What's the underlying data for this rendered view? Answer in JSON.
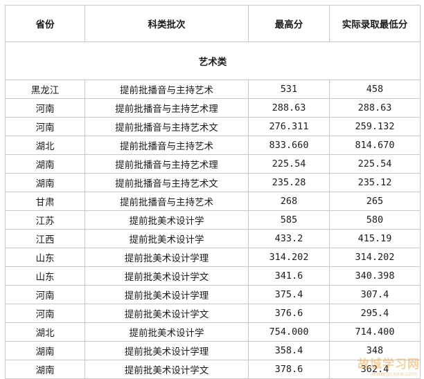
{
  "table": {
    "headers": {
      "province": "省份",
      "batch": "科类批次",
      "max": "最高分",
      "min": "实际录取最低分"
    },
    "section_title": "艺术类",
    "rows": [
      {
        "province": "黑龙江",
        "batch": "提前批播音与主持艺术",
        "max": "531",
        "min": "458"
      },
      {
        "province": "河南",
        "batch": "提前批播音与主持艺术理",
        "max": "288.63",
        "min": "288.63"
      },
      {
        "province": "河南",
        "batch": "提前批播音与主持艺术文",
        "max": "276.311",
        "min": "259.132"
      },
      {
        "province": "湖北",
        "batch": "提前批播音与主持艺术",
        "max": "833.660",
        "min": "814.670"
      },
      {
        "province": "湖南",
        "batch": "提前批播音与主持艺术理",
        "max": "225.54",
        "min": "225.54"
      },
      {
        "province": "湖南",
        "batch": "提前批播音与主持艺术文",
        "max": "235.28",
        "min": "235.12"
      },
      {
        "province": "甘肃",
        "batch": "提前批播音与主持艺术",
        "max": "268",
        "min": "265"
      },
      {
        "province": "江苏",
        "batch": "提前批美术设计学",
        "max": "585",
        "min": "580"
      },
      {
        "province": "江西",
        "batch": "提前批美术设计学",
        "max": "433.2",
        "min": "415.19"
      },
      {
        "province": "山东",
        "batch": "提前批美术设计学理",
        "max": "314.202",
        "min": "314.202"
      },
      {
        "province": "山东",
        "batch": "提前批美术设计学文",
        "max": "341.6",
        "min": "340.398"
      },
      {
        "province": "河南",
        "batch": "提前批美术设计学理",
        "max": "375.4",
        "min": "307.4"
      },
      {
        "province": "河南",
        "batch": "提前批美术设计学文",
        "max": "376.6",
        "min": "295.4"
      },
      {
        "province": "湖北",
        "batch": "提前批美术设计学",
        "max": "754.000",
        "min": "714.400"
      },
      {
        "province": "湖南",
        "batch": "提前批美术设计学理",
        "max": "358.4",
        "min": "348"
      },
      {
        "province": "湖南",
        "batch": "提前批美术设计学文",
        "max": "378.6",
        "min": "362.4"
      }
    ]
  },
  "watermark": {
    "text": "故城学习网",
    "sub": "www.gcxxw.com",
    "color": "#f0962a"
  }
}
